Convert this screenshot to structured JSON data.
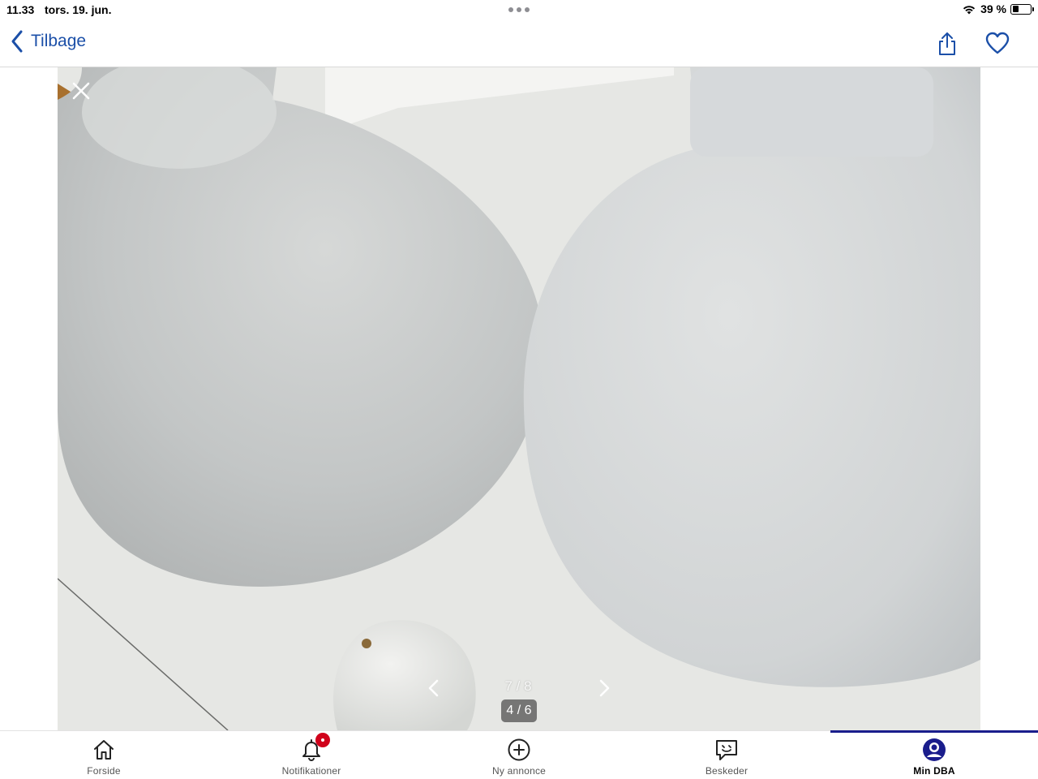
{
  "status_bar": {
    "time": "11.33",
    "date": "tors. 19. jun.",
    "battery_text": "39 %",
    "battery_level": 0.39
  },
  "nav": {
    "back_label": "Tilbage",
    "share_icon": "share-icon",
    "favorite_icon": "heart-icon"
  },
  "gallery": {
    "close_icon": "close-icon",
    "prev_icon": "chevron-left-icon",
    "next_icon": "chevron-right-icon",
    "overall_counter": "7 / 8",
    "image_counter": "4 / 6"
  },
  "tabs": [
    {
      "label": "Forside",
      "icon": "home-icon"
    },
    {
      "label": "Notifikationer",
      "icon": "bell-icon"
    },
    {
      "label": "Ny annonce",
      "icon": "plus-circle-icon"
    },
    {
      "label": "Beskeder",
      "icon": "chat-icon"
    },
    {
      "label": "Min DBA",
      "icon": "profile-icon",
      "active": true
    }
  ],
  "colors": {
    "accent": "#1b4fa8",
    "tab_active_indicator": "#1a1d8c",
    "badge": "#d0021b"
  }
}
